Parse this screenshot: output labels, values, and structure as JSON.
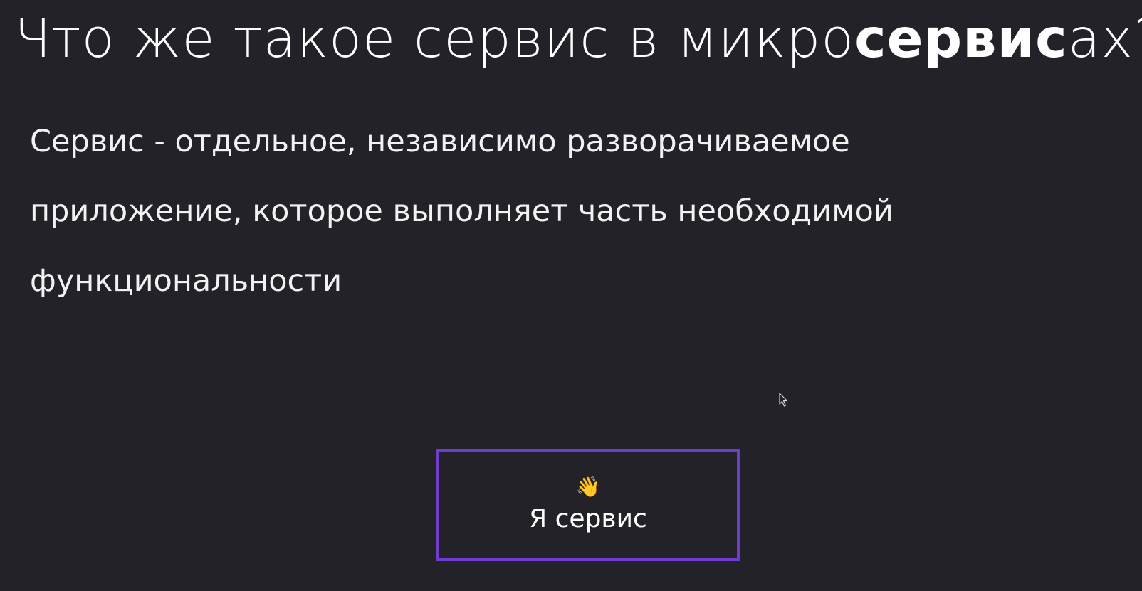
{
  "slide": {
    "title_prefix": "Что же такое сервис в микро",
    "title_bold": "сервис",
    "title_suffix": "ах?",
    "definition_lines": [
      "Сервис - отдельное, независимо разворачиваемое",
      "приложение, которое выполняет часть необходимой",
      "функциональности"
    ]
  },
  "service_card": {
    "icon": "waving-hand-icon",
    "icon_glyph": "👋",
    "label": "Я сервис",
    "border_color": "#6f3ccf"
  },
  "colors": {
    "background": "#232228",
    "text": "#ffffff"
  },
  "cursor": {
    "icon": "mouse-pointer-icon"
  }
}
